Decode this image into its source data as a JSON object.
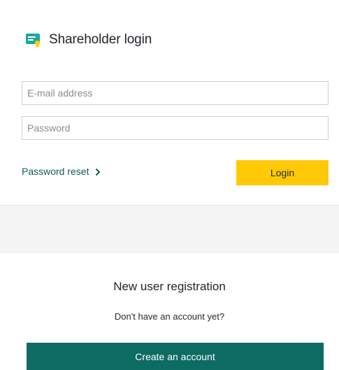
{
  "header": {
    "title": "Shareholder login",
    "icon": "certificate-icon"
  },
  "form": {
    "email_placeholder": "E-mail address",
    "password_placeholder": "Password",
    "reset_link": "Password reset",
    "login_button": "Login"
  },
  "registration": {
    "title": "New user registration",
    "subtitle": "Don't have an account yet?",
    "create_button": "Create an account"
  },
  "colors": {
    "accent_green": "#0c6b63",
    "login_yellow": "#ffc907",
    "icon_teal": "#1aa89a"
  }
}
